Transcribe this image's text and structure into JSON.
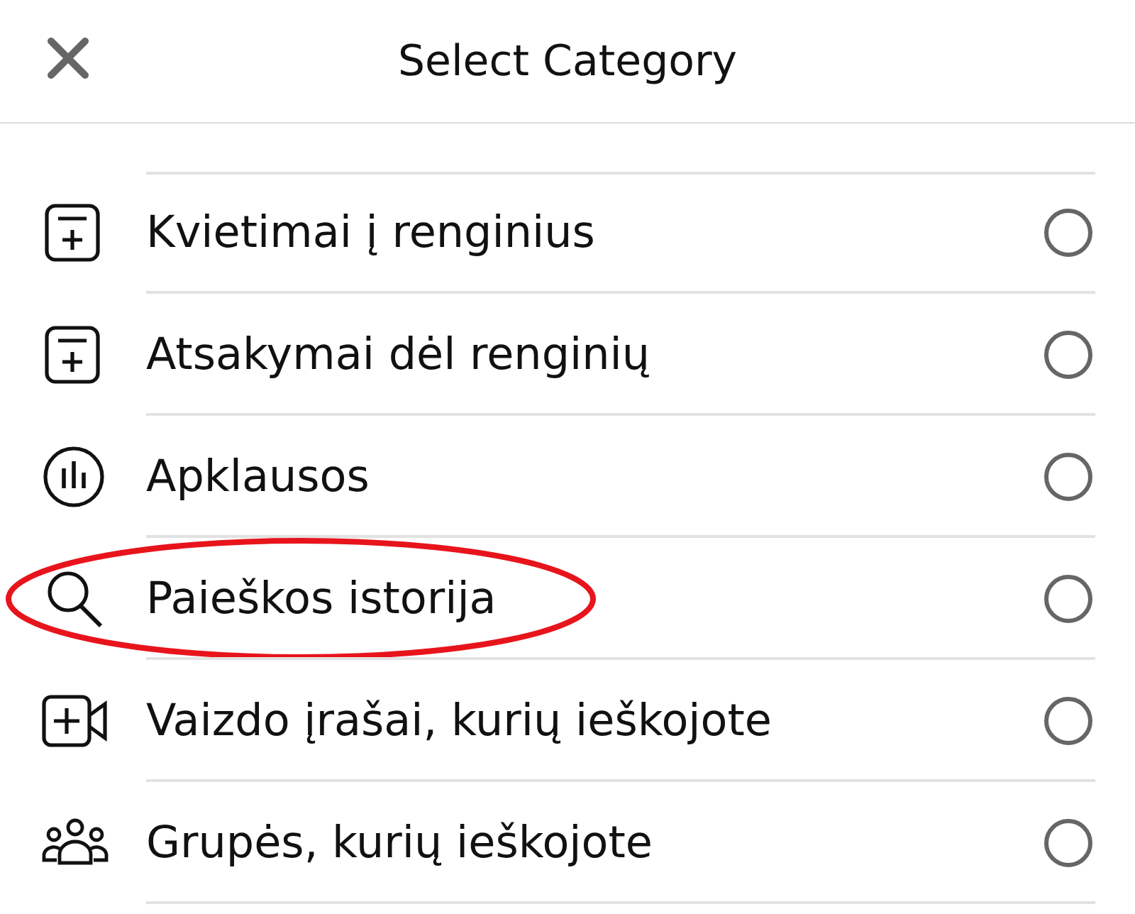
{
  "header": {
    "title": "Select Category"
  },
  "categories": [
    {
      "label": "Kvietimai į renginius",
      "kind": "calendar",
      "selected": false,
      "circled": false
    },
    {
      "label": "Atsakymai dėl renginių",
      "kind": "calendar",
      "selected": false,
      "circled": false
    },
    {
      "label": "Apklausos",
      "kind": "poll",
      "selected": false,
      "circled": false
    },
    {
      "label": "Paieškos istorija",
      "kind": "search",
      "selected": false,
      "circled": true
    },
    {
      "label": "Vaizdo įrašai, kurių ieškojote",
      "kind": "video",
      "selected": false,
      "circled": false
    },
    {
      "label": "Grupės, kurių ieškojote",
      "kind": "group",
      "selected": false,
      "circled": false
    }
  ]
}
